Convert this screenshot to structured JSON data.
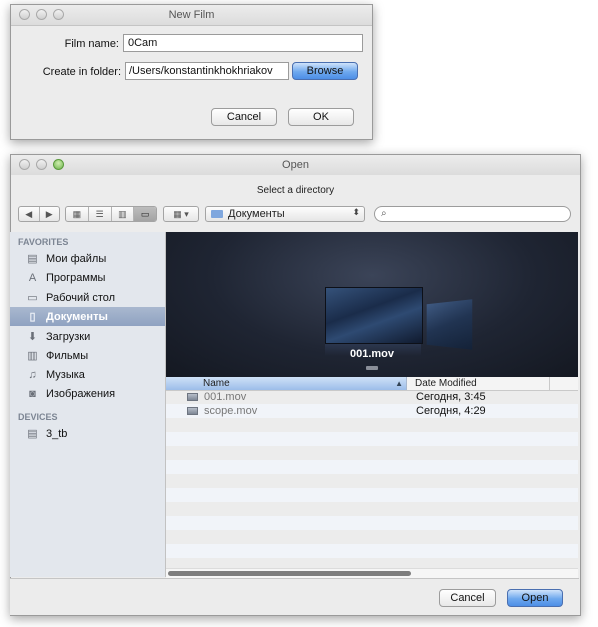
{
  "new_film": {
    "title": "New Film",
    "film_name_label": "Film name:",
    "film_name_value": "0Cam",
    "folder_label": "Create in folder:",
    "folder_value": "/Users/konstantinkhokhriakov",
    "browse_label": "Browse",
    "cancel_label": "Cancel",
    "ok_label": "OK"
  },
  "open_dialog": {
    "title": "Open",
    "subtitle": "Select a directory",
    "location": "Документы",
    "search_placeholder": "",
    "preview_caption": "001.mov",
    "columns": {
      "name": "Name",
      "date": "Date Modified"
    },
    "files": [
      {
        "name": "001.mov",
        "date": "Сегодня, 3:45"
      },
      {
        "name": "scope.mov",
        "date": "Сегодня, 4:29"
      }
    ],
    "cancel_label": "Cancel",
    "open_label": "Open"
  },
  "sidebar": {
    "favorites_header": "FAVORITES",
    "favorites": [
      {
        "label": "Мои файлы",
        "icon": "all-my-files-icon"
      },
      {
        "label": "Программы",
        "icon": "applications-icon"
      },
      {
        "label": "Рабочий стол",
        "icon": "desktop-icon"
      },
      {
        "label": "Документы",
        "icon": "documents-icon",
        "selected": true
      },
      {
        "label": "Загрузки",
        "icon": "downloads-icon"
      },
      {
        "label": "Фильмы",
        "icon": "movies-icon"
      },
      {
        "label": "Музыка",
        "icon": "music-icon"
      },
      {
        "label": "Изображения",
        "icon": "pictures-icon"
      }
    ],
    "devices_header": "DEVICES",
    "devices": [
      {
        "label": "3_tb",
        "icon": "hard-drive-icon"
      }
    ]
  },
  "colors": {
    "accent_blue": "#5b95e8",
    "sidebar_bg": "#e3e7ed",
    "sidebar_selected": "#9aabc6",
    "preview_bg": "#1c2230"
  }
}
